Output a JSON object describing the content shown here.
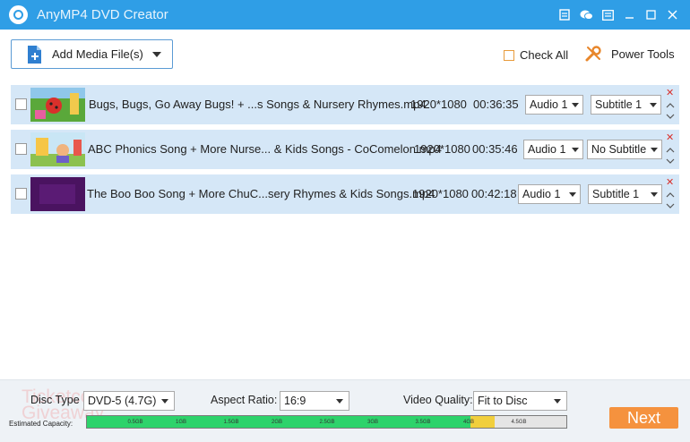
{
  "app": {
    "title": "AnyMP4 DVD Creator"
  },
  "toolbar": {
    "add_media_label": "Add Media File(s)",
    "check_all_label": "Check All",
    "power_tools_label": "Power Tools"
  },
  "items": [
    {
      "name": "Bugs, Bugs, Go Away Bugs! + ...s Songs & Nursery Rhymes.mp4",
      "resolution": "1920*1080",
      "duration": "00:36:35",
      "audio": "Audio 1",
      "subtitle": "Subtitle 1"
    },
    {
      "name": "ABC Phonics Song + More Nurse... & Kids Songs - CoComelon.mp4",
      "resolution": "1920*1080",
      "duration": "00:35:46",
      "audio": "Audio 1",
      "subtitle": "No Subtitle"
    },
    {
      "name": "The Boo Boo Song + More ChuC...sery Rhymes & Kids Songs.mp4",
      "resolution": "1920*1080",
      "duration": "00:42:18",
      "audio": "Audio 1",
      "subtitle": "Subtitle 1"
    }
  ],
  "settings": {
    "disc_type_label": "Disc Type",
    "disc_type_value": "DVD-5 (4.7G)",
    "aspect_ratio_label": "Aspect Ratio:",
    "aspect_ratio_value": "16:9",
    "video_quality_label": "Video Quality:",
    "video_quality_value": "Fit to Disc",
    "capacity_label": "Estimated Capacity:",
    "capacity_ticks": [
      "0.5GB",
      "1GB",
      "1.5GB",
      "2GB",
      "2.5GB",
      "3GB",
      "3.5GB",
      "4GB",
      "4.5GB"
    ],
    "capacity_used_fraction": 0.8,
    "capacity_warn_end_fraction": 0.85,
    "next_label": "Next"
  },
  "watermark": {
    "line1": "Ticketcouon",
    "line2": "Giveaway"
  },
  "colors": {
    "titlebar": "#2f9ee6",
    "capacity_used": "#2dd36b",
    "capacity_warn": "#f1cf3d",
    "next_button": "#f5923e"
  }
}
